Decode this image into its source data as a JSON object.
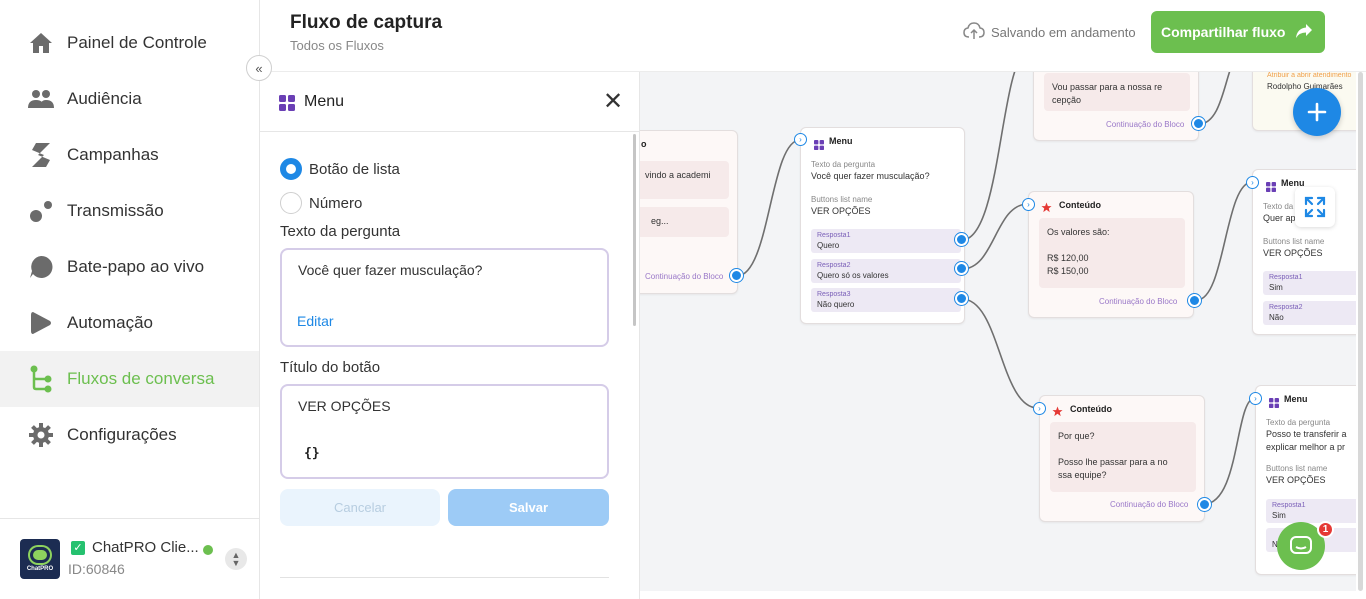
{
  "sidebar": {
    "items": [
      {
        "label": "Painel de Controle",
        "icon": "home-icon"
      },
      {
        "label": "Audiência",
        "icon": "people-icon"
      },
      {
        "label": "Campanhas",
        "icon": "campaign-icon"
      },
      {
        "label": "Transmissão",
        "icon": "broadcast-icon"
      },
      {
        "label": "Bate-papo ao vivo",
        "icon": "chat-bubble-icon"
      },
      {
        "label": "Automação",
        "icon": "play-icon"
      },
      {
        "label": "Fluxos de conversa",
        "icon": "flow-icon",
        "active": true
      },
      {
        "label": "Configurações",
        "icon": "gear-icon"
      }
    ],
    "account": {
      "name": "ChatPRO Clie...",
      "id": "ID:60846",
      "logo_text": "ChatPRO"
    }
  },
  "header": {
    "title": "Fluxo de captura",
    "subtitle": "Todos os Fluxos",
    "saving_status": "Salvando em andamento",
    "share_label": "Compartilhar fluxo"
  },
  "panel": {
    "title": "Menu",
    "radio_list": "Botão de lista",
    "radio_number": "Número",
    "question_label": "Texto da pergunta",
    "question_value": "Você quer fazer musculação?",
    "edit_label": "Editar",
    "button_title_label": "Título do botão",
    "button_title_value": "VER OPÇÕES",
    "braces": "{}",
    "cancel_label": "Cancelar",
    "save_label": "Salvar"
  },
  "canvas": {
    "partial_left": {
      "title": "o",
      "bubble1": "vindo a academi",
      "bubble2": "eg...",
      "cont": "Continuação do Bloco"
    },
    "menu_main": {
      "title": "Menu",
      "q_label": "Texto da pergunta",
      "q_value": "Você quer fazer musculação?",
      "b_label": "Buttons list name",
      "b_value": "VER OPÇÕES",
      "responses": [
        {
          "k": "Resposta1",
          "v": "Quero"
        },
        {
          "k": "Resposta2",
          "v": "Quero só os valores"
        },
        {
          "k": "Resposta3",
          "v": "Não quero"
        }
      ]
    },
    "top_partial": {
      "bubble": "Vou passar para a nossa re\ncepção",
      "cont": "Continuação do Bloco"
    },
    "top_right_partial": {
      "line1": "Atribuir a abrir atendimento",
      "line2": "Rodolpho Guimarães"
    },
    "content1": {
      "title": "Conteúdo",
      "bubble": "Os valores são:\n\nR$ 120,00\nR$ 150,00",
      "cont": "Continuação do Bloco"
    },
    "content2": {
      "title": "Conteúdo",
      "bubble": "Por que?\n\nPosso lhe passar para a no\nssa equipe?",
      "cont": "Continuação do Bloco"
    },
    "menu_right1": {
      "title": "Menu",
      "q_label": "Texto da",
      "q_value": "Quer ap      agor",
      "b_label": "Buttons list name",
      "b_value": "VER OPÇÕES",
      "responses": [
        {
          "k": "Resposta1",
          "v": "Sim"
        },
        {
          "k": "Resposta2",
          "v": "Não"
        }
      ]
    },
    "menu_right2": {
      "title": "Menu",
      "q_label": "Texto da pergunta",
      "q_value": "Posso te transferir a\nexplicar melhor a pr",
      "b_label": "Buttons list name",
      "b_value": "VER OPÇÕES",
      "responses": [
        {
          "k": "Resposta1",
          "v": "Sim"
        },
        {
          "k": "",
          "v": "N"
        }
      ]
    },
    "chat_badge": "1"
  },
  "colors": {
    "brand_green": "#6cbf4f",
    "accent_blue": "#1e88e5",
    "menu_purple": "#6a3fb5",
    "content_red": "#e53935"
  }
}
